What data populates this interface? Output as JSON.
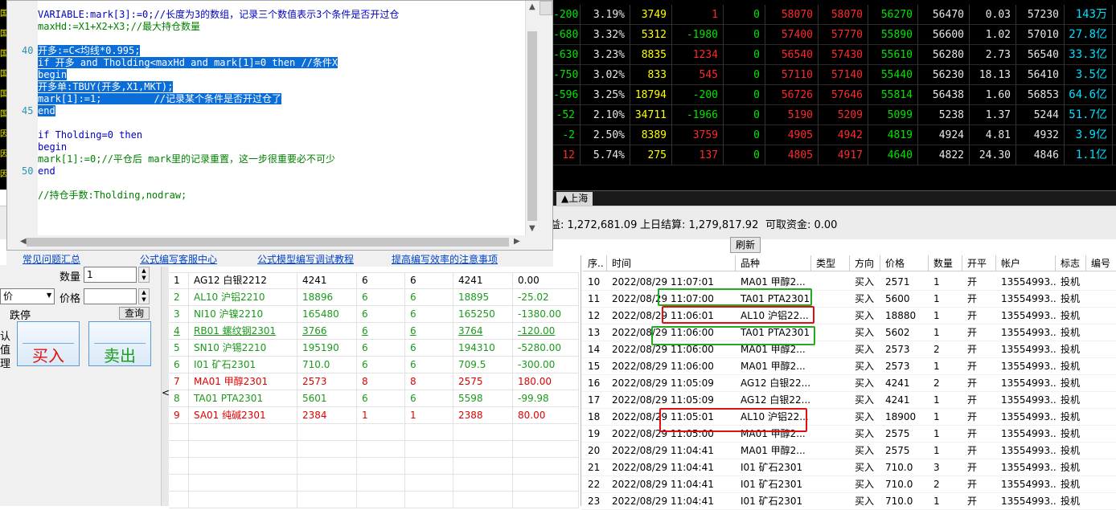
{
  "quote_board": {
    "left_marks": [
      "国",
      "国",
      "国",
      "国",
      "国",
      "国",
      "因",
      "因",
      "因"
    ],
    "rows": [
      [
        "-200",
        "3.19%",
        "3749",
        "1",
        "0",
        "58070",
        "58070",
        "56270",
        "56470",
        "0.03",
        "57230",
        "143万"
      ],
      [
        "-680",
        "3.32%",
        "5312",
        "-1980",
        "0",
        "57400",
        "57770",
        "55890",
        "56600",
        "1.02",
        "57010",
        "27.8亿"
      ],
      [
        "-630",
        "3.23%",
        "8835",
        "1234",
        "0",
        "56540",
        "57430",
        "55610",
        "56280",
        "2.73",
        "56540",
        "33.3亿"
      ],
      [
        "-750",
        "3.02%",
        "833",
        "545",
        "0",
        "57110",
        "57140",
        "55440",
        "56230",
        "18.13",
        "56410",
        "3.5亿"
      ],
      [
        "-596",
        "3.25%",
        "18794",
        "-200",
        "0",
        "56726",
        "57646",
        "55814",
        "56438",
        "1.60",
        "56853",
        "64.6亿"
      ],
      [
        "-52",
        "2.10%",
        "34711",
        "-1966",
        "0",
        "5190",
        "5209",
        "5099",
        "5238",
        "1.37",
        "5244",
        "51.7亿"
      ],
      [
        "-2",
        "2.50%",
        "8389",
        "3759",
        "0",
        "4905",
        "4942",
        "4819",
        "4924",
        "4.81",
        "4932",
        "3.9亿"
      ],
      [
        "12",
        "5.74%",
        "275",
        "137",
        "0",
        "4805",
        "4917",
        "4640",
        "4822",
        "24.30",
        "4846",
        "1.1亿"
      ]
    ],
    "tab": "▲上海"
  },
  "editor": {
    "gutter": [
      "40",
      "45",
      "50"
    ],
    "lines": [
      {
        "text": "VARIABLE:mark[3]:=0;//长度为3的数组，记录三个数值表示3个条件是否开过仓",
        "style": "kw"
      },
      {
        "text": "maxHd:=X1+X2+X3;//最大持仓数量",
        "style": "cm"
      },
      {
        "text": "",
        "style": ""
      },
      {
        "text": "开多:=C<均线*0.995;",
        "style": "sel"
      },
      {
        "text": "if 开多 and Tholding<maxHd and mark[1]=0 then //条件X",
        "style": "sel"
      },
      {
        "text": "begin",
        "style": "sel"
      },
      {
        "text": "开多单:TBUY(开多,X1,MKT);",
        "style": "sel"
      },
      {
        "text": "mark[1]:=1;         //记录某个条件是否开过仓了",
        "style": "sel"
      },
      {
        "text": "end",
        "style": "sel"
      },
      {
        "text": "",
        "style": ""
      },
      {
        "text": "if Tholding=0 then",
        "style": "kw"
      },
      {
        "text": "begin",
        "style": "kw"
      },
      {
        "text": "mark[1]:=0;//平仓后 mark里的记录重置，这一步很重要必不可少",
        "style": "cm"
      },
      {
        "text": "end",
        "style": "kw"
      },
      {
        "text": "",
        "style": ""
      },
      {
        "text": "//持仓手数:Tholding,nodraw;",
        "style": "cm"
      }
    ]
  },
  "help_links": [
    "常见问题汇总",
    "公式编写客服中心",
    "公式模型编写调试教程",
    "提高编写效率的注意事项"
  ],
  "account": {
    "equity_partial": "益: 1,272,681.09",
    "prev_settle": "上日结算: 1,279,817.92",
    "available": "可取资金: 0.00",
    "refresh": "刷新"
  },
  "order_panel": {
    "qty_label": "数量",
    "qty_value": "1",
    "price_label": "价格",
    "price_type": "价",
    "limit_label": "跌停",
    "query": "查询",
    "side_text": [
      "认",
      "值",
      "理"
    ],
    "buy": "买入",
    "sell": "卖出"
  },
  "positions": [
    {
      "n": "1",
      "name": "AG12 白银2212",
      "a": "4241",
      "b": "6",
      "c": "6",
      "d": "4241",
      "pnl": "0.00",
      "color": ""
    },
    {
      "n": "2",
      "name": "AL10 沪铝2210",
      "a": "18896",
      "b": "6",
      "c": "6",
      "d": "18895",
      "pnl": "-25.02",
      "color": "gg"
    },
    {
      "n": "3",
      "name": "NI10 沪镍2210",
      "a": "165480",
      "b": "6",
      "c": "6",
      "d": "165250",
      "pnl": "-1380.00",
      "color": "gg"
    },
    {
      "n": "4",
      "name": "RB01 螺纹钢2301",
      "a": "3766",
      "b": "6",
      "c": "6",
      "d": "3764",
      "pnl": "-120.00",
      "color": "gg"
    },
    {
      "n": "5",
      "name": "SN10 沪锡2210",
      "a": "195190",
      "b": "6",
      "c": "6",
      "d": "194310",
      "pnl": "-5280.00",
      "color": "gg"
    },
    {
      "n": "6",
      "name": "I01 矿石2301",
      "a": "710.0",
      "b": "6",
      "c": "6",
      "d": "709.5",
      "pnl": "-300.00",
      "color": "gg"
    },
    {
      "n": "7",
      "name": "MA01 甲醇2301",
      "a": "2573",
      "b": "8",
      "c": "8",
      "d": "2575",
      "pnl": "180.00",
      "color": "rr"
    },
    {
      "n": "8",
      "name": "TA01 PTA2301",
      "a": "5601",
      "b": "6",
      "c": "6",
      "d": "5598",
      "pnl": "-99.98",
      "color": "gg"
    },
    {
      "n": "9",
      "name": "SA01 纯碱2301",
      "a": "2384",
      "b": "1",
      "c": "1",
      "d": "2388",
      "pnl": "80.00",
      "color": "rr"
    }
  ],
  "trades": {
    "headers": [
      "序..",
      "时间",
      "品种",
      "类型",
      "方向",
      "价格",
      "数量",
      "开平",
      "帐户",
      "标志",
      "编号"
    ],
    "rows": [
      [
        "10",
        "2022/08/29 11:07:01",
        "MA01 甲醇2...",
        "",
        "买入",
        "2571",
        "1",
        "开",
        "13554993...",
        "投机"
      ],
      [
        "11",
        "2022/08/29 11:07:00",
        "TA01 PTA2301",
        "",
        "买入",
        "5600",
        "1",
        "开",
        "13554993...",
        "投机"
      ],
      [
        "12",
        "2022/08/29 11:06:01",
        "AL10 沪铝22...",
        "",
        "买入",
        "18880",
        "1",
        "开",
        "13554993...",
        "投机"
      ],
      [
        "13",
        "2022/08/29 11:06:00",
        "TA01 PTA2301",
        "",
        "买入",
        "5602",
        "1",
        "开",
        "13554993...",
        "投机"
      ],
      [
        "14",
        "2022/08/29 11:06:00",
        "MA01 甲醇2...",
        "",
        "买入",
        "2573",
        "2",
        "开",
        "13554993...",
        "投机"
      ],
      [
        "15",
        "2022/08/29 11:06:00",
        "MA01 甲醇2...",
        "",
        "买入",
        "2573",
        "1",
        "开",
        "13554993...",
        "投机"
      ],
      [
        "16",
        "2022/08/29 11:05:09",
        "AG12 白银22...",
        "",
        "买入",
        "4241",
        "2",
        "开",
        "13554993...",
        "投机"
      ],
      [
        "17",
        "2022/08/29 11:05:09",
        "AG12 白银22...",
        "",
        "买入",
        "4241",
        "1",
        "开",
        "13554993...",
        "投机"
      ],
      [
        "18",
        "2022/08/29 11:05:01",
        "AL10 沪铝22...",
        "",
        "买入",
        "18900",
        "1",
        "开",
        "13554993...",
        "投机"
      ],
      [
        "19",
        "2022/08/29 11:05:00",
        "MA01 甲醇2...",
        "",
        "买入",
        "2575",
        "1",
        "开",
        "13554993...",
        "投机"
      ],
      [
        "20",
        "2022/08/29 11:04:41",
        "MA01 甲醇2...",
        "",
        "买入",
        "2575",
        "1",
        "开",
        "13554993...",
        "投机"
      ],
      [
        "21",
        "2022/08/29 11:04:41",
        "I01 矿石2301",
        "",
        "买入",
        "710.0",
        "3",
        "开",
        "13554993...",
        "投机"
      ],
      [
        "22",
        "2022/08/29 11:04:41",
        "I01 矿石2301",
        "",
        "买入",
        "710.0",
        "2",
        "开",
        "13554993...",
        "投机"
      ],
      [
        "23",
        "2022/08/29 11:04:41",
        "I01 矿石2301",
        "",
        "买入",
        "710.0",
        "1",
        "开",
        "13554993...",
        "投机"
      ]
    ]
  },
  "colors": {
    "green_box": "#22aa22",
    "red_box": "#e01010"
  }
}
